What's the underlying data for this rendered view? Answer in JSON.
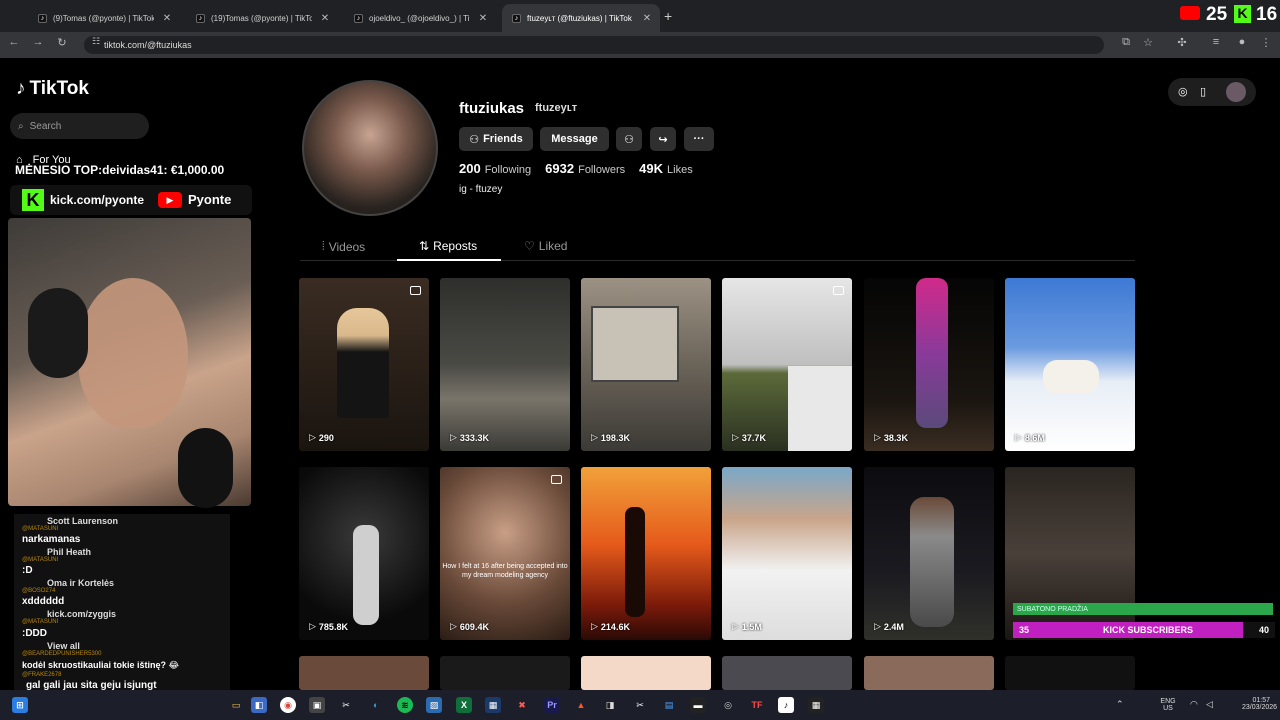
{
  "browser": {
    "tabs": [
      {
        "label": "(9)Tomas (@pyonte) | TikTok",
        "active": false
      },
      {
        "label": "(19)Tomas (@pyonte) | TikTok",
        "active": false
      },
      {
        "label": "ojoeldivo_ (@ojoeldivo_) | TikTok",
        "active": false
      },
      {
        "label": "ftuzeyʟт (@ftuziukas) | TikTok",
        "active": true
      }
    ],
    "new_tab": "+",
    "url": "tiktok.com/@ftuziukas",
    "overlay_count_a": "25",
    "overlay_count_b": "16"
  },
  "sidebar": {
    "logo": "TikTok",
    "search_placeholder": "Search",
    "for_you": "For You"
  },
  "stream_overlay": {
    "top_donor": "MĖNESIO TOP:deividas41: €1,000.00",
    "kick_url": "kick.com/pyonte",
    "youtube_name": "Pyonte"
  },
  "chat": [
    {
      "user": "Scott Laurenson",
      "text": "narkamanas",
      "tag": "@MATASUNI"
    },
    {
      "user": "Phil Heath",
      "text": ":D",
      "tag": "@MATASUNI"
    },
    {
      "user": "Oma ir Kortelės",
      "text": "xdddddd",
      "tag": "@BOSO274"
    },
    {
      "user": "kick.com/zyggis",
      "text": ":DDD",
      "tag": "@MATASUNI"
    },
    {
      "user": "View all",
      "text": "kodėl skruostikauliai tokie ištinę? 😂",
      "tag": "@BEARDEDPUNISHER5300"
    },
    {
      "user": "",
      "text": "gal gali jau sita geju isjungt",
      "tag": "@FRAKE2678"
    }
  ],
  "profile": {
    "username": "ftuziukas",
    "nickname": "ftuzeyʟт",
    "friends_label": "Friends",
    "message_label": "Message",
    "following": "200",
    "following_label": "Following",
    "followers": "6932",
    "followers_label": "Followers",
    "likes": "49K",
    "likes_label": "Likes",
    "bio": "ig - ftuzey"
  },
  "profile_tabs": [
    {
      "label": "Videos",
      "active": false
    },
    {
      "label": "Reposts",
      "active": true
    },
    {
      "label": "Liked",
      "active": false
    }
  ],
  "videos": [
    {
      "views": "290",
      "multi": true
    },
    {
      "views": "333.3K",
      "multi": false
    },
    {
      "views": "198.3K",
      "multi": false
    },
    {
      "views": "37.7K",
      "multi": true
    },
    {
      "views": "38.3K",
      "multi": false
    },
    {
      "views": "8.6M",
      "multi": false
    },
    {
      "views": "785.8K",
      "multi": false
    },
    {
      "views": "609.4K",
      "multi": true,
      "caption": "How I felt at 16 after being accepted into my dream modeling agency"
    },
    {
      "views": "214.6K",
      "multi": false
    },
    {
      "views": "1.5M",
      "multi": false
    },
    {
      "views": "2.4M",
      "multi": false
    },
    {
      "views": "",
      "multi": false
    }
  ],
  "stream_goal": {
    "sub_label": "SUBATONO PRADŽIA",
    "kick_count": "35",
    "kick_label": "KICK SUBSCRIBERS",
    "kick_goal": "40"
  },
  "taskbar": {
    "lang": "ENG",
    "region": "US",
    "time": "01:57",
    "date": "23/03/2026"
  },
  "colors": {
    "kick_green": "#53fc18",
    "youtube_red": "#ff0000",
    "tiktok_bg": "#000000"
  }
}
